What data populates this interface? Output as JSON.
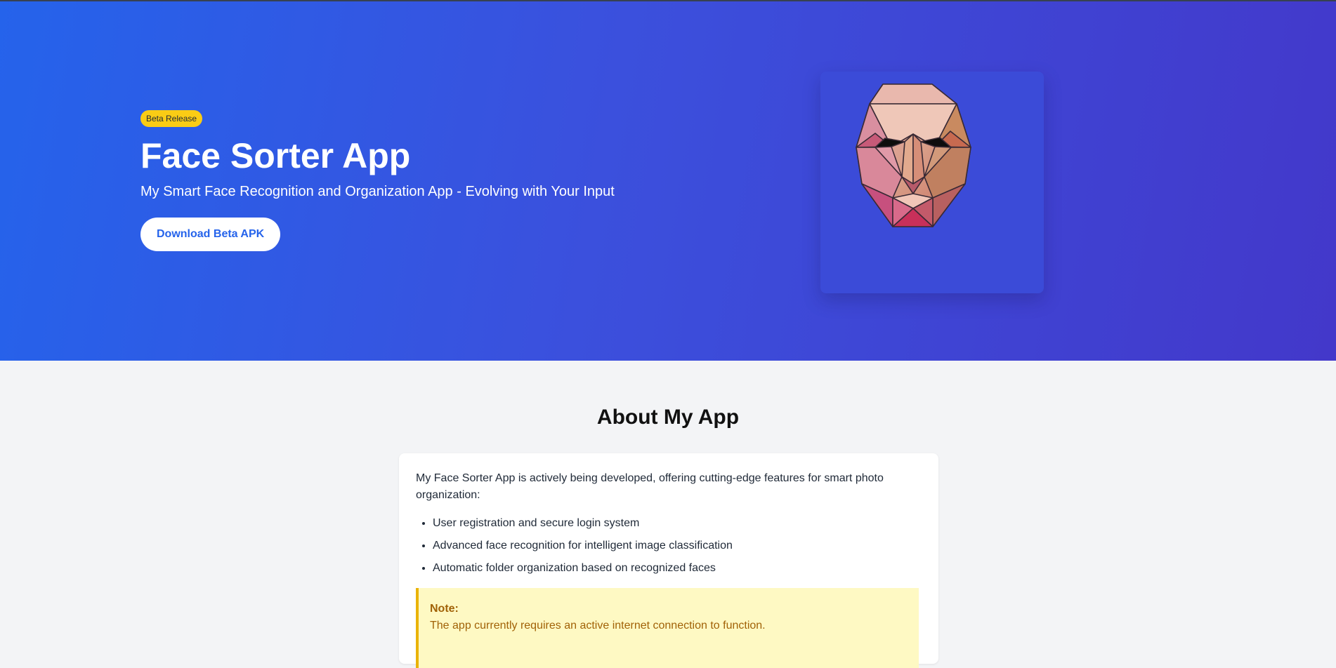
{
  "hero": {
    "badge": "Beta Release",
    "title": "Face Sorter App",
    "subtitle": "My Smart Face Recognition and Organization App - Evolving with Your Input",
    "download_label": "Download Beta APK",
    "image_icon": "low-poly-face-illustration"
  },
  "about": {
    "title": "About My App",
    "intro": "My Face Sorter App is actively being developed, offering cutting-edge features for smart photo organization:",
    "features": [
      "User registration and secure login system",
      "Advanced face recognition for intelligent image classification",
      "Automatic folder organization based on recognized faces"
    ],
    "note": {
      "title": "Note:",
      "text": "The app currently requires an active internet connection to function."
    }
  },
  "colors": {
    "hero_gradient_start": "#2563eb",
    "hero_gradient_end": "#4338ca",
    "badge": "#facc15",
    "button_text": "#2563eb",
    "note_background": "#fef9c3",
    "note_border": "#eab308",
    "note_text": "#a16207",
    "page_background": "#f3f4f6"
  }
}
